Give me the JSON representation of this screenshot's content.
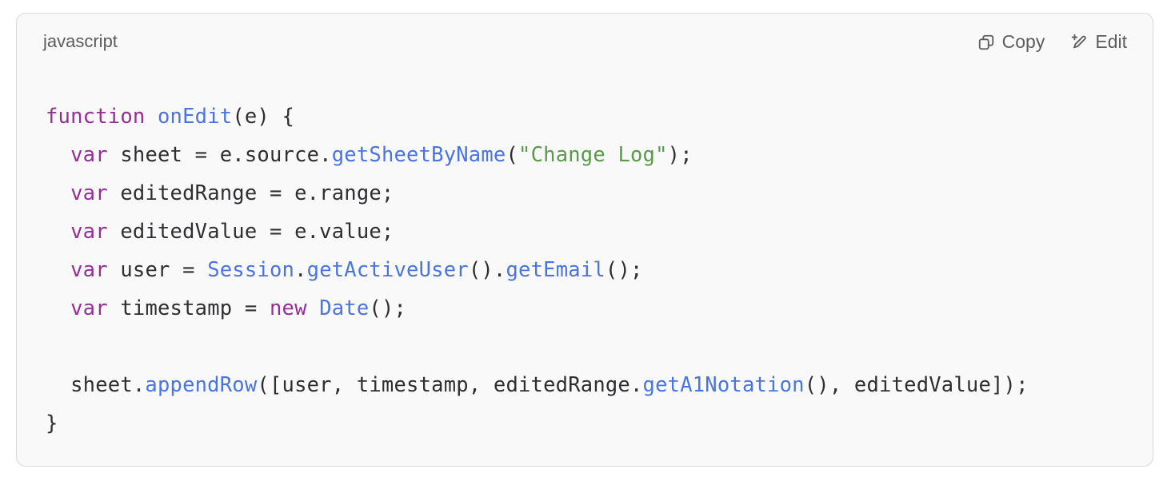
{
  "header": {
    "language": "javascript",
    "copy_label": "Copy",
    "copy_icon": "copy-icon",
    "edit_label": "Edit",
    "edit_icon": "edit-pencil-sparkle-icon"
  },
  "colors": {
    "keyword": "#962e97",
    "function": "#4a74e0",
    "string": "#5a9a4a",
    "plain": "#2f2f33",
    "background": "#f9f9f9"
  },
  "code_lines": [
    [
      [
        "kw",
        "function"
      ],
      [
        "pl",
        " "
      ],
      [
        "fn",
        "onEdit"
      ],
      [
        "pl",
        "(e) {"
      ]
    ],
    [
      [
        "pl",
        "  "
      ],
      [
        "kw",
        "var"
      ],
      [
        "pl",
        " sheet = e.source."
      ],
      [
        "fn",
        "getSheetByName"
      ],
      [
        "pl",
        "("
      ],
      [
        "str",
        "\"Change Log\""
      ],
      [
        "pl",
        ");"
      ]
    ],
    [
      [
        "pl",
        "  "
      ],
      [
        "kw",
        "var"
      ],
      [
        "pl",
        " editedRange = e.range;"
      ]
    ],
    [
      [
        "pl",
        "  "
      ],
      [
        "kw",
        "var"
      ],
      [
        "pl",
        " editedValue = e.value;"
      ]
    ],
    [
      [
        "pl",
        "  "
      ],
      [
        "kw",
        "var"
      ],
      [
        "pl",
        " user = "
      ],
      [
        "fn",
        "Session"
      ],
      [
        "pl",
        "."
      ],
      [
        "fn",
        "getActiveUser"
      ],
      [
        "pl",
        "()."
      ],
      [
        "fn",
        "getEmail"
      ],
      [
        "pl",
        "();"
      ]
    ],
    [
      [
        "pl",
        "  "
      ],
      [
        "kw",
        "var"
      ],
      [
        "pl",
        " timestamp = "
      ],
      [
        "kw",
        "new"
      ],
      [
        "pl",
        " "
      ],
      [
        "fn",
        "Date"
      ],
      [
        "pl",
        "();"
      ]
    ],
    [],
    [
      [
        "pl",
        "  sheet."
      ],
      [
        "fn",
        "appendRow"
      ],
      [
        "pl",
        "([user, timestamp, editedRange."
      ],
      [
        "fn",
        "getA1Notation"
      ],
      [
        "pl",
        "(), editedValue]);"
      ]
    ],
    [
      [
        "pl",
        "}"
      ]
    ]
  ]
}
